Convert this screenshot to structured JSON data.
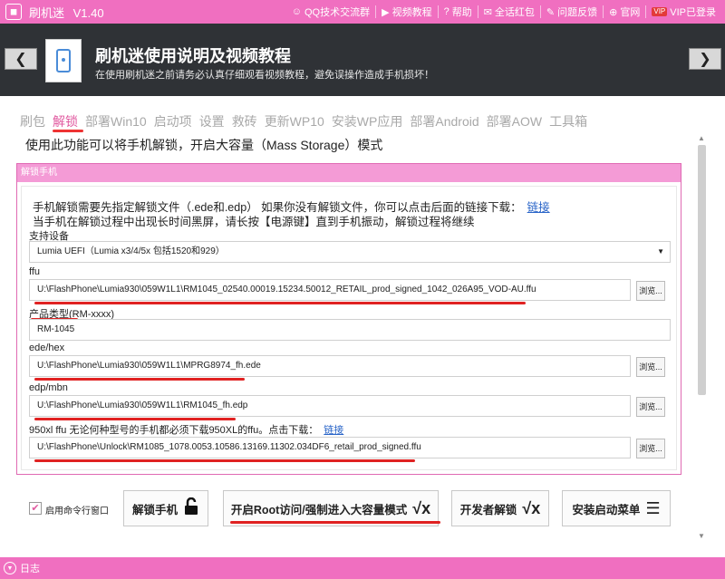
{
  "titlebar": {
    "app_name": "刷机迷",
    "version": "V1.40",
    "links": [
      {
        "icon": "qq-icon",
        "glyph": "☺",
        "label": "QQ技术交流群"
      },
      {
        "icon": "video-icon",
        "glyph": "▶",
        "label": "视频教程"
      },
      {
        "icon": "help-icon",
        "glyph": "?",
        "label": "帮助"
      },
      {
        "icon": "message-icon",
        "glyph": "✉",
        "label": "全话红包"
      },
      {
        "icon": "feedback-icon",
        "glyph": "✎",
        "label": "问题反馈"
      },
      {
        "icon": "globe-icon",
        "glyph": "⊕",
        "label": "官网"
      },
      {
        "icon": "vip-icon",
        "badge": "VIP",
        "label": "VIP已登录"
      }
    ]
  },
  "header": {
    "title": "刷机迷使用说明及视频教程",
    "subtitle": "在使用刷机迷之前请务必认真仔细观看视频教程，避免误操作造成手机损坏！"
  },
  "tabs": [
    "刷包",
    "解锁",
    "部署Win10",
    "启动项",
    "设置",
    "救砖",
    "更新WP10",
    "安装WP应用",
    "部署Android",
    "部署AOW",
    "工具箱"
  ],
  "active_tab": "解锁",
  "description": "使用此功能可以将手机解锁，开启大容量（Mass Storage）模式",
  "panel": {
    "title": "解锁手机",
    "note1": "手机解锁需要先指定解锁文件（.ede和.edp） 如果你没有解锁文件，你可以点击后面的链接下载：",
    "note1_link": "链接",
    "note2": "当手机在解锁过程中出现长时间黑屏，请长按【电源键】直到手机振动，解锁过程将继续",
    "device_label": "支持设备",
    "device_value": "Lumia UEFI（Lumia x3/4/5x 包括1520和929）",
    "ffu_label": "ffu",
    "ffu_value": "U:\\FlashPhone\\Lumia930\\059W1L1\\RM1045_02540.00019.15234.50012_RETAIL_prod_signed_1042_026A95_VOD-AU.ffu",
    "model_label": "产品类型(RM-xxxx)",
    "model_value": "RM-1045",
    "ede_label": "ede/hex",
    "ede_value": "U:\\FlashPhone\\Lumia930\\059W1L1\\MPRG8974_fh.ede",
    "edp_label": "edp/mbn",
    "edp_value": "U:\\FlashPhone\\Lumia930\\059W1L1\\RM1045_fh.edp",
    "xl_label": "950xl ffu    无论何种型号的手机都必须下载950XL的ffu。点击下载：",
    "xl_link": "链接",
    "xl_value": "U:\\FlashPhone\\Unlock\\RM1085_1078.0053.10586.13169.11302.034DF6_retail_prod_signed.ffu",
    "browse_label": "浏览..."
  },
  "bottom": {
    "checkbox_label": "启用命令行窗口",
    "checkbox_checked": true,
    "unlock_button": "解锁手机",
    "root_button": "开启Root访问/强制进入大容量模式",
    "dev_unlock_button": "开发者解锁",
    "boot_menu_button": "安装启动菜单"
  },
  "statusbar": {
    "label": "日志"
  },
  "colors": {
    "accent": "#f06fc0",
    "header_bg": "#2f3236",
    "link": "#2a65c8",
    "active_tab": "#e15aa0",
    "annotation_red": "#e02222"
  }
}
